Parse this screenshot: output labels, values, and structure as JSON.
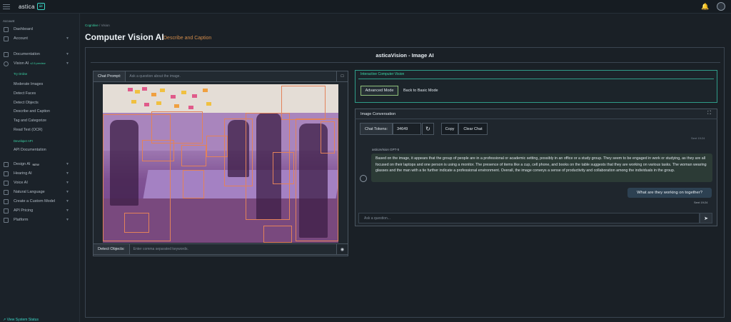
{
  "app": {
    "logo_text": "astica",
    "logo_badge": "ai"
  },
  "sidebar": {
    "section_account": "Account",
    "dashboard": "Dashboard",
    "account": "Account",
    "documentation": "Documentation",
    "vision_ai": "Vision AI",
    "vision_badge": "v2.5 preview",
    "try_online": "Try Online",
    "sub_vision": [
      "Moderate Images",
      "Detect Faces",
      "Detect Objects",
      "Describe and Caption",
      "Tag and Categorize",
      "Read Text (OCR)"
    ],
    "developer_api": "Developer API",
    "api_docs": "API Documentation",
    "design_ai": "Design AI",
    "new_badge": "NEW",
    "hearing_ai": "Hearing AI",
    "voice_ai": "Voice AI",
    "natural_language": "Natural Language",
    "custom_model": "Create a Custom Model",
    "api_pricing": "API Pricing",
    "platform": "Platform",
    "status_link": "View System Status"
  },
  "header": {
    "breadcrumb_parent": "Cognitive",
    "breadcrumb_sep": "/",
    "breadcrumb_current": "Vision",
    "title": "Computer Vision AI",
    "subtitle": "Describe and Caption"
  },
  "main": {
    "frame_title": "asticaVision - Image AI",
    "chat_prompt_label": "Chat Prompt:",
    "chat_prompt_placeholder": "Ask a question about the image.",
    "detect_label": "Detect Objects:",
    "detect_placeholder": "Enter comma separated keywords."
  },
  "interactive": {
    "title": "Interactive Computer Vision",
    "advanced_mode": "Advanced Mode",
    "basic_mode": "Back to Basic Mode"
  },
  "conversation": {
    "title": "Image Conversation",
    "tokens_label": "Chat Tokens:",
    "tokens_value": "34649",
    "copy": "Copy",
    "clear": "Clear Chat",
    "sent_top": "Sent 19:24",
    "bot_name": "asticaVision GPT-5",
    "bot_message": "Based on the image, it appears that the group of people are in a professional or academic setting, possibly in an office or a study group. They seem to be engaged in work or studying, as they are all focused on their laptops and one person is using a monitor. The presence of items like a cup, cell phone, and books on the table suggests that they are working on various tasks. The woman wearing glasses and the man with a tie further indicate a professional environment. Overall, the image conveys a sense of productivity and collaboration among the individuals in the group.",
    "user_message": "What are they working on together?",
    "sent_bottom": "Sent 19:24",
    "ask_placeholder": "Ask a question..."
  },
  "colors": {
    "accent": "#3bd6a6",
    "bbox": "#e3825a",
    "overlay": "#7a3caa"
  }
}
